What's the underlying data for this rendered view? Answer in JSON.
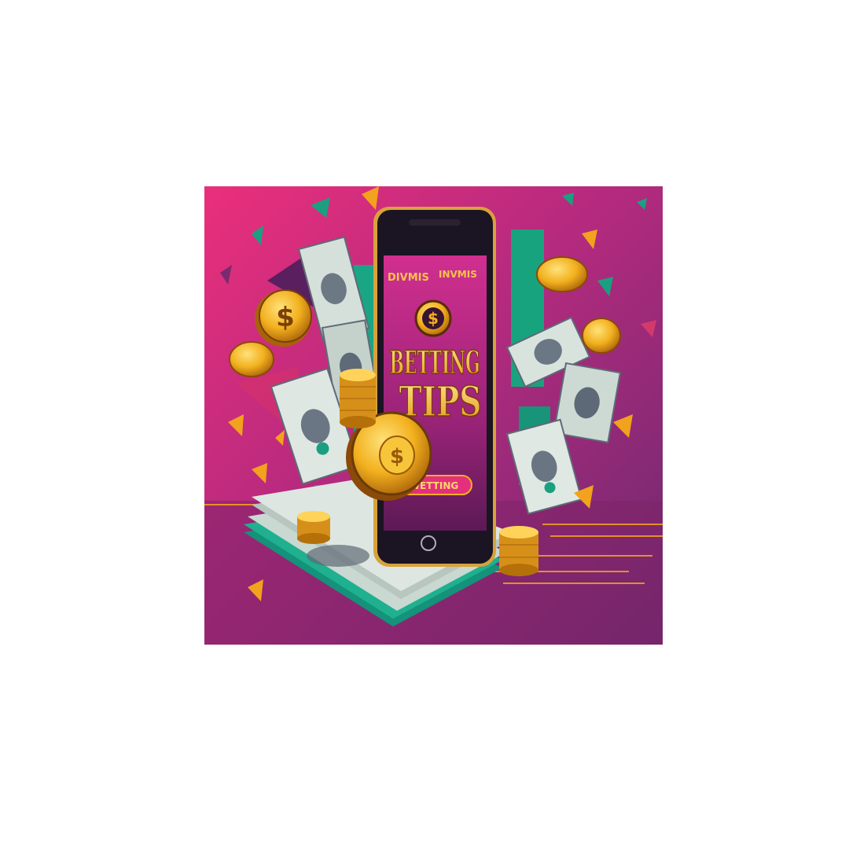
{
  "image": {
    "type": "illustration",
    "colors": {
      "page_background": "#ffffff",
      "panel_top_left": "#e8307a",
      "panel_bottom": "#7a1e66",
      "panel_right": "#6b2a73",
      "gold": "#f2b01e",
      "gold_dark": "#b5700a",
      "teal": "#1aa080",
      "phone_frame": "#1b1422",
      "phone_bezel": "#d7a23a",
      "screen_top": "#c42a86",
      "screen_bottom": "#6a1c5e",
      "cash": "#c9d6cf",
      "cash_dark": "#5f6a76"
    },
    "phone_screen": {
      "header_left": "DIVMIS",
      "header_right": "INVMIS",
      "title_line1": "BETTING",
      "title_line2": "TIPS",
      "button": "WETTING",
      "coin_symbol": "$"
    },
    "icons": [
      "dollar-coin",
      "banknote",
      "coin-stack",
      "smartphone",
      "confetti"
    ]
  }
}
